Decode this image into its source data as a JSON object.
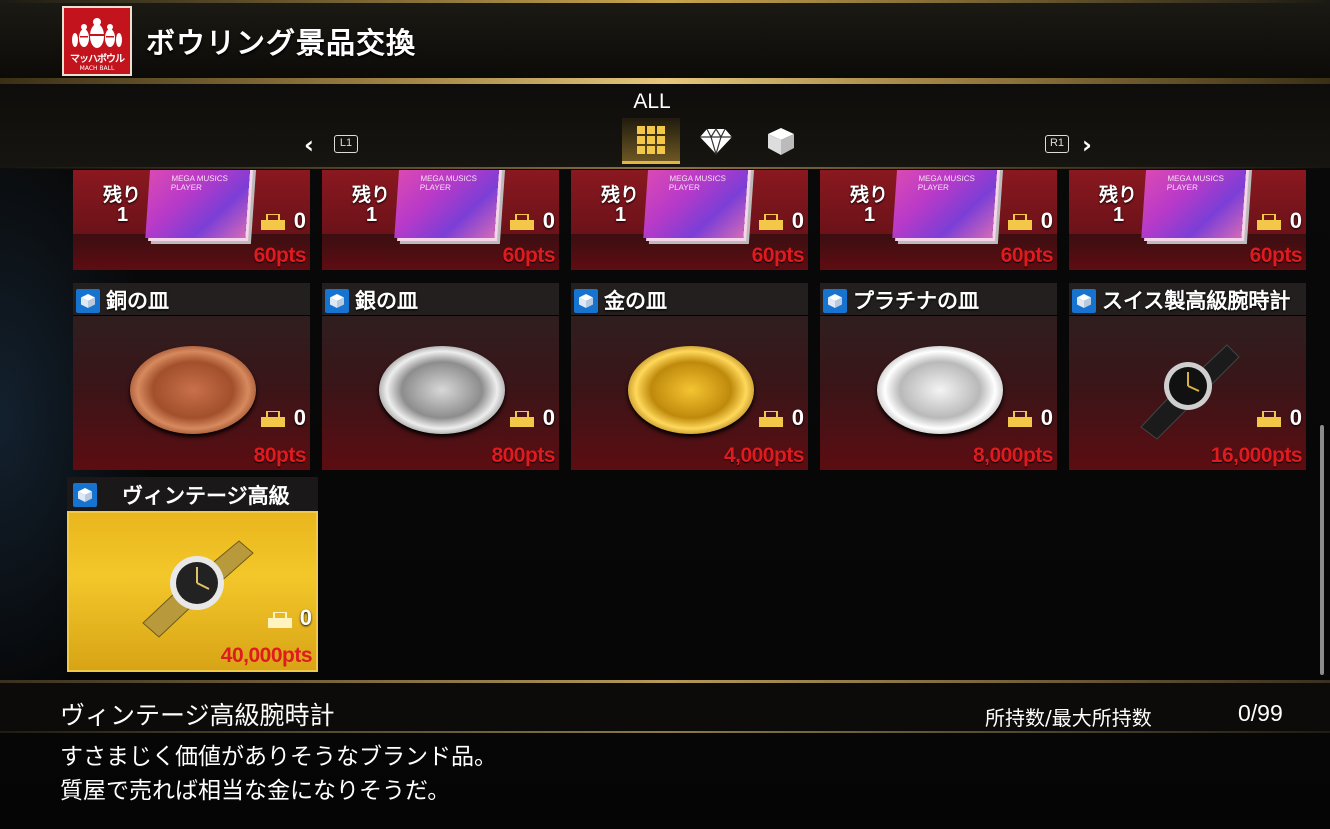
{
  "header": {
    "title": "ボウリング景品交換",
    "logo_text": "マッハボウル",
    "logo_sub": "MACH BALL"
  },
  "tabs": {
    "active_label": "ALL",
    "left_hint": "L1",
    "right_hint": "R1",
    "items": [
      {
        "icon": "grid-icon"
      },
      {
        "icon": "diamond-icon"
      },
      {
        "icon": "box-icon"
      }
    ]
  },
  "cd_items": [
    {
      "remain_label": "残り",
      "remain": "1",
      "cover_text": "MEGA MUSICS PLAYER",
      "owned": "0",
      "price": "60pts"
    },
    {
      "remain_label": "残り",
      "remain": "1",
      "cover_text": "MEGA MUSICS PLAYER",
      "owned": "0",
      "price": "60pts"
    },
    {
      "remain_label": "残り",
      "remain": "1",
      "cover_text": "MEGA MUSICS PLAYER",
      "owned": "0",
      "price": "60pts"
    },
    {
      "remain_label": "残り",
      "remain": "1",
      "cover_text": "MEGA MUSICS PLAYER",
      "owned": "0",
      "price": "60pts"
    },
    {
      "remain_label": "残り",
      "remain": "1",
      "cover_text": "MEGA MUSICS PLAYER",
      "owned": "0",
      "price": "60pts"
    }
  ],
  "items": [
    {
      "name": "銅の皿",
      "owned": "0",
      "price": "80pts"
    },
    {
      "name": "銀の皿",
      "owned": "0",
      "price": "800pts"
    },
    {
      "name": "金の皿",
      "owned": "0",
      "price": "4,000pts"
    },
    {
      "name": "プラチナの皿",
      "owned": "0",
      "price": "8,000pts"
    },
    {
      "name": "スイス製高級腕時計",
      "owned": "0",
      "price": "16,000pts"
    }
  ],
  "selected_item": {
    "name": "ヴィンテージ高級",
    "owned": "0",
    "price": "40,000pts"
  },
  "info": {
    "title": "ヴィンテージ高級腕時計",
    "owned_label": "所持数/最大所持数",
    "owned_value": "0/99",
    "description_line1": "すさまじく価値がありそうなブランド品。",
    "description_line2": "質屋で売れば相当な金になりそうだ。"
  }
}
